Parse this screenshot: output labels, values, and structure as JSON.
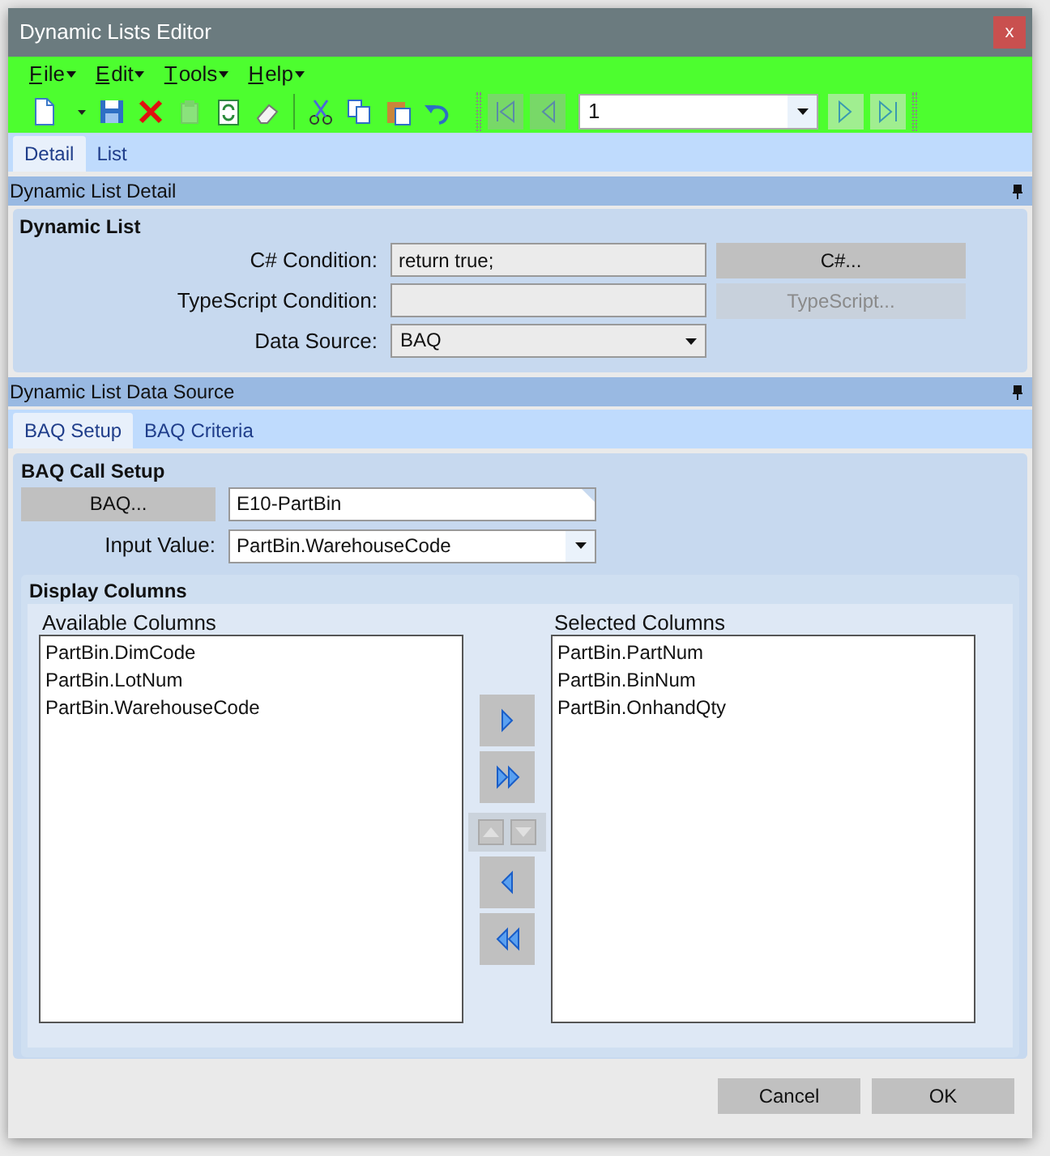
{
  "window": {
    "title": "Dynamic Lists Editor",
    "close": "x"
  },
  "menu": [
    "File",
    "Edit",
    "Tools",
    "Help"
  ],
  "toolbar": [
    {
      "kind": "new"
    },
    {
      "kind": "dropdown"
    },
    {
      "kind": "save"
    },
    {
      "kind": "delete"
    },
    {
      "kind": "clip",
      "disabled": true
    },
    {
      "kind": "refresh"
    },
    {
      "kind": "eraser"
    },
    {
      "kind": "sep"
    },
    {
      "kind": "cut"
    },
    {
      "kind": "copy"
    },
    {
      "kind": "paste"
    },
    {
      "kind": "undo"
    }
  ],
  "navigator": {
    "first_disabled": true,
    "prev_disabled": true,
    "record": "1",
    "next_disabled": false,
    "last_disabled": false
  },
  "tabs": [
    {
      "label": "Detail",
      "selected": true
    },
    {
      "label": "List",
      "selected": false
    }
  ],
  "detail_section": {
    "title": "Dynamic List Detail",
    "group": "Dynamic List",
    "rows": [
      {
        "label": "C# Condition:",
        "kind": "text",
        "value": "return true;",
        "button": "C#...",
        "disabled": false
      },
      {
        "label": "TypeScript Condition:",
        "kind": "text",
        "value": "",
        "button": "TypeScript...",
        "disabled": true
      },
      {
        "label": "Data Source:",
        "kind": "dropdown",
        "value": "BAQ"
      }
    ]
  },
  "source_section": {
    "title": "Dynamic List Data Source",
    "tabs": [
      {
        "label": "BAQ Setup",
        "selected": true
      },
      {
        "label": "BAQ Criteria",
        "selected": false
      }
    ],
    "group": "BAQ Call Setup",
    "baq_button": "BAQ...",
    "baq_value": "E10-PartBin",
    "input_label": "Input Value:",
    "input_value": "PartBin.WarehouseCode",
    "display_columns": {
      "title": "Display Columns",
      "available": {
        "title": "Available Columns",
        "items": [
          "PartBin.DimCode",
          "PartBin.LotNum",
          "PartBin.WarehouseCode"
        ]
      },
      "selected": {
        "title": "Selected Columns",
        "items": [
          "PartBin.PartNum",
          "PartBin.BinNum",
          "PartBin.OnhandQty"
        ]
      },
      "move_buttons": [
        {
          "kind": "right",
          "disabled": false
        },
        {
          "kind": "all-right",
          "disabled": false
        },
        {
          "kind": "updown",
          "disabled": true
        },
        {
          "kind": "left",
          "disabled": false
        },
        {
          "kind": "all-left",
          "disabled": false
        }
      ]
    }
  },
  "buttons": [
    "Cancel",
    "OK"
  ]
}
